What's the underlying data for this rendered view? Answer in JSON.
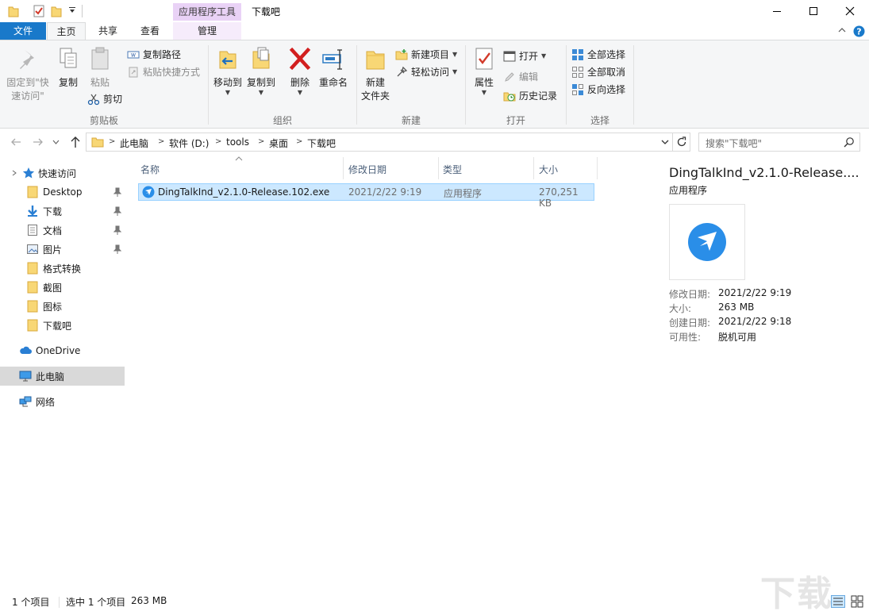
{
  "window": {
    "title": "下载吧",
    "context_tab_group": "应用程序工具"
  },
  "tabs": {
    "file": "文件",
    "home": "主页",
    "share": "共享",
    "view": "查看",
    "manage": "管理"
  },
  "ribbon": {
    "clipboard": {
      "label": "剪贴板",
      "pin": "固定到\"快",
      "pin2": "速访问\"",
      "copy": "复制",
      "paste": "粘贴",
      "copy_path": "复制路径",
      "paste_shortcut": "粘贴快捷方式",
      "cut": "剪切"
    },
    "organize": {
      "label": "组织",
      "move_to": "移动到",
      "copy_to": "复制到",
      "delete": "删除",
      "rename": "重命名"
    },
    "new": {
      "label": "新建",
      "new_folder": "新建",
      "new_folder2": "文件夹",
      "new_item": "新建项目",
      "easy_access": "轻松访问"
    },
    "open": {
      "label": "打开",
      "properties": "属性",
      "open": "打开",
      "edit": "编辑",
      "history": "历史记录"
    },
    "select": {
      "label": "选择",
      "select_all": "全部选择",
      "select_none": "全部取消",
      "invert": "反向选择"
    }
  },
  "address": {
    "crumbs": [
      "此电脑",
      "软件 (D:)",
      "tools",
      "桌面",
      "下载吧"
    ],
    "search_placeholder": "搜索\"下载吧\""
  },
  "nav": {
    "quick_access": "快速访问",
    "items": [
      {
        "label": "Desktop",
        "pinned": true
      },
      {
        "label": "下载",
        "pinned": true
      },
      {
        "label": "文档",
        "pinned": true
      },
      {
        "label": "图片",
        "pinned": true
      },
      {
        "label": "格式转换",
        "pinned": false
      },
      {
        "label": "截图",
        "pinned": false
      },
      {
        "label": "图标",
        "pinned": false
      },
      {
        "label": "下载吧",
        "pinned": false
      }
    ],
    "onedrive": "OneDrive",
    "this_pc": "此电脑",
    "network": "网络"
  },
  "columns": {
    "name": "名称",
    "modified": "修改日期",
    "type": "类型",
    "size": "大小"
  },
  "files": [
    {
      "name": "DingTalkInd_v2.1.0-Release.102.exe",
      "modified": "2021/2/22 9:19",
      "type": "应用程序",
      "size": "270,251 KB"
    }
  ],
  "preview": {
    "name": "DingTalkInd_v2.1.0-Release....",
    "type": "应用程序",
    "props": [
      {
        "key": "修改日期:",
        "value": "2021/2/22 9:19"
      },
      {
        "key": "大小:",
        "value": "263 MB"
      },
      {
        "key": "创建日期:",
        "value": "2021/2/22 9:18"
      },
      {
        "key": "可用性:",
        "value": "脱机可用"
      }
    ]
  },
  "status": {
    "count": "1 个项目",
    "selected": "选中 1 个项目",
    "size": "263 MB"
  },
  "watermark": "下载吧",
  "colors": {
    "accent": "#1979ca",
    "selection": "#cce8ff",
    "context_tab": "#e9d2f6",
    "folder": "#f8d775"
  }
}
